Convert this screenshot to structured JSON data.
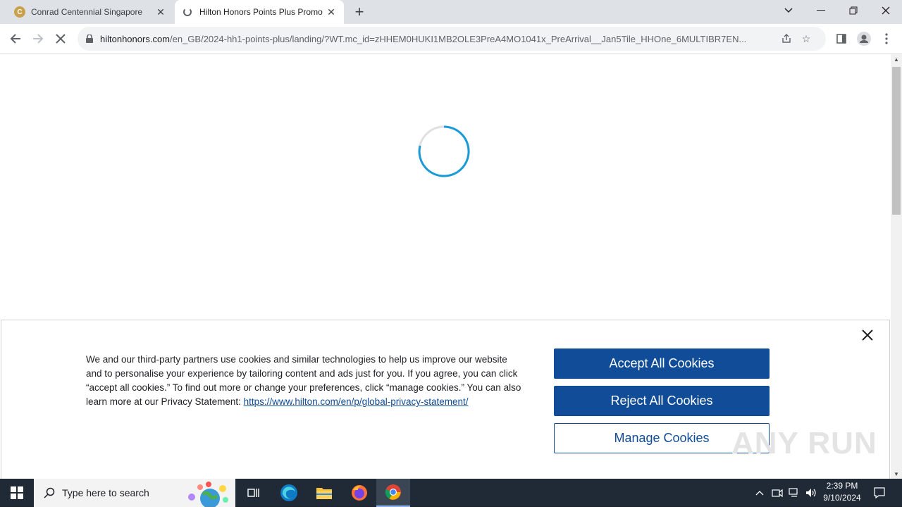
{
  "tabs": [
    {
      "title": "Conrad Centennial Singapore",
      "favicon_letter": "C"
    },
    {
      "title": "Hilton Honors Points Plus Promo"
    }
  ],
  "address_bar": {
    "host": "hiltonhonors.com",
    "path": "/en_GB/2024-hh1-points-plus/landing/?WT.mc_id=zHHEM0HUKI1MB2OLE3PreA4MO1041x_PreArrival__Jan5Tile_HHOne_6MULTIBR7EN..."
  },
  "cookie_banner": {
    "text": "We and our third-party partners use cookies and similar technologies to help us improve our website and to personalise your experience by tailoring content and ads just for you. If you agree, you can click “accept all cookies.” To find out more or change your preferences, click “manage cookies.” You can also learn more at our Privacy Statement: ",
    "link_text": "https://www.hilton.com/en/p/global-privacy-statement/",
    "accept_label": "Accept All Cookies",
    "reject_label": "Reject All Cookies",
    "manage_label": "Manage Cookies"
  },
  "watermark": "ANY RUN",
  "taskbar": {
    "search_placeholder": "Type here to search",
    "time": "2:39 PM",
    "date": "9/10/2024"
  },
  "colors": {
    "brand_blue": "#104c97",
    "spinner_blue": "#1a9ad6"
  }
}
